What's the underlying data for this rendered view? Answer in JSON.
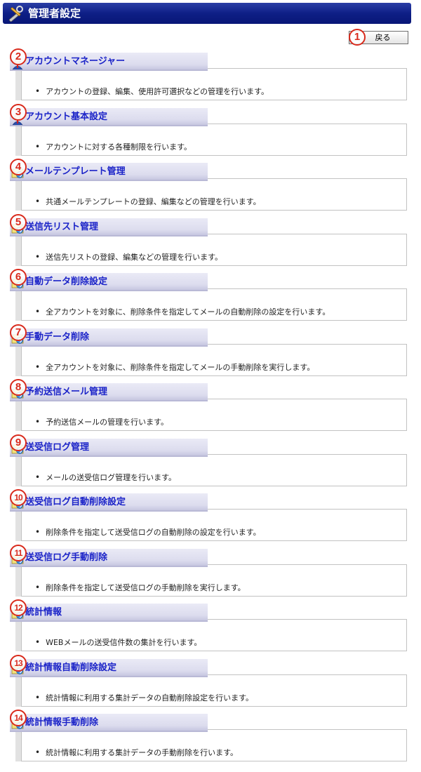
{
  "header": {
    "title": "管理者設定"
  },
  "toolbar": {
    "back_label": "戻る",
    "back_badge": "1"
  },
  "sections": [
    {
      "badge": "2",
      "icon": "user-icon",
      "title": "アカウントマネージャー",
      "description": "アカウントの登録、編集、使用許可選択などの管理を行います。"
    },
    {
      "badge": "3",
      "icon": "user-icon",
      "title": "アカウント基本設定",
      "description": "アカウントに対する各種制限を行います。"
    },
    {
      "badge": "4",
      "icon": "mail-icon",
      "title": "メールテンプレート管理",
      "description": "共通メールテンプレートの登録、編集などの管理を行います。"
    },
    {
      "badge": "5",
      "icon": "mail-icon",
      "title": "送信先リスト管理",
      "description": "送信先リストの登録、編集などの管理を行います。"
    },
    {
      "badge": "6",
      "icon": "mail-icon",
      "title": "自動データ削除設定",
      "description": "全アカウントを対象に、削除条件を指定してメールの自動削除の設定を行います。"
    },
    {
      "badge": "7",
      "icon": "mail-icon",
      "title": "手動データ削除",
      "description": "全アカウントを対象に、削除条件を指定してメールの手動削除を実行します。"
    },
    {
      "badge": "8",
      "icon": "mail-icon",
      "title": "予約送信メール管理",
      "description": "予約送信メールの管理を行います。"
    },
    {
      "badge": "9",
      "icon": "mail-icon",
      "title": "送受信ログ管理",
      "description": "メールの送受信ログ管理を行います。"
    },
    {
      "badge": "10",
      "icon": "mail-icon",
      "title": "送受信ログ自動削除設定",
      "description": "削除条件を指定して送受信ログの自動削除の設定を行います。"
    },
    {
      "badge": "11",
      "icon": "mail-icon",
      "title": "送受信ログ手動削除",
      "description": "削除条件を指定して送受信ログの手動削除を実行します。"
    },
    {
      "badge": "12",
      "icon": "mail-icon",
      "title": "統計情報",
      "description": "WEBメールの送受信件数の集計を行います。"
    },
    {
      "badge": "13",
      "icon": "mail-icon",
      "title": "統計情報自動削除設定",
      "description": "統計情報に利用する集計データの自動削除設定を行います。"
    },
    {
      "badge": "14",
      "icon": "mail-icon",
      "title": "統計情報手動削除",
      "description": "統計情報に利用する集計データの手動削除を行います。"
    }
  ],
  "colors": {
    "title_bar": "#0e1f86",
    "link": "#1b23c8",
    "badge": "#d92a1c"
  }
}
